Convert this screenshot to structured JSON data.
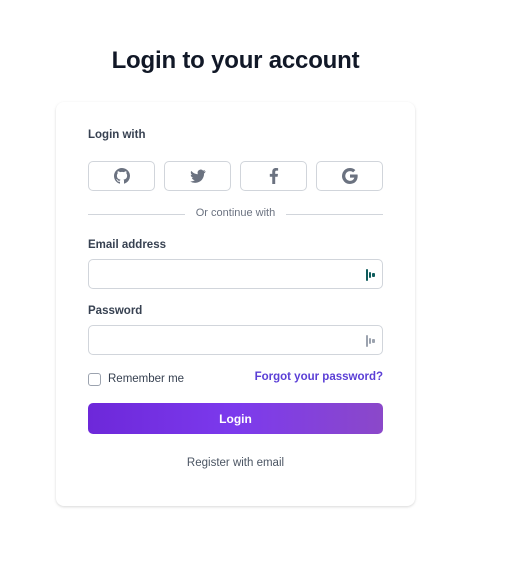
{
  "page": {
    "title": "Login to your account"
  },
  "card": {
    "login_with_label": "Login with",
    "social": [
      {
        "name": "github",
        "icon": "github-icon"
      },
      {
        "name": "twitter",
        "icon": "twitter-icon"
      },
      {
        "name": "facebook",
        "icon": "facebook-icon"
      },
      {
        "name": "google",
        "icon": "google-icon"
      }
    ],
    "divider_text": "Or continue with",
    "email": {
      "label": "Email address",
      "value": "",
      "placeholder": "",
      "icon": "password-manager-icon",
      "icon_color": "#0f5c5c"
    },
    "password": {
      "label": "Password",
      "value": "",
      "placeholder": "",
      "icon": "password-manager-icon",
      "icon_color": "#9ca3af"
    },
    "remember_label": "Remember me",
    "remember_checked": false,
    "forgot_label": "Forgot your password?",
    "login_button": "Login",
    "register_label": "Register with email"
  },
  "colors": {
    "accent": "#6d28d9",
    "link": "#5b3fd6",
    "border": "#d1d5db"
  }
}
